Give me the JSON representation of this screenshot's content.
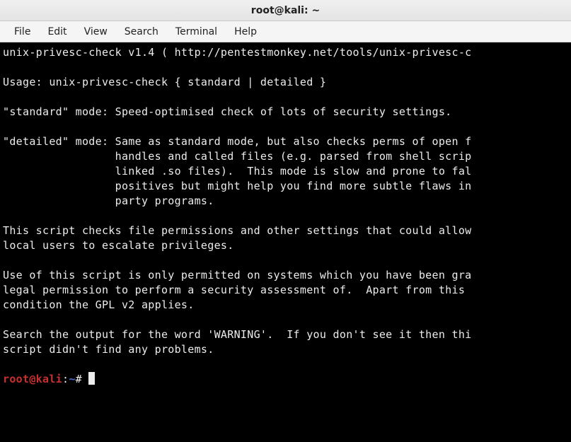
{
  "window": {
    "title": "root@kali: ~"
  },
  "menu": {
    "items": [
      "File",
      "Edit",
      "View",
      "Search",
      "Terminal",
      "Help"
    ]
  },
  "terminal": {
    "lines": [
      "unix-privesc-check v1.4 ( http://pentestmonkey.net/tools/unix-privesc-c",
      "",
      "Usage: unix-privesc-check { standard | detailed }",
      "",
      "\"standard\" mode: Speed-optimised check of lots of security settings.",
      "",
      "\"detailed\" mode: Same as standard mode, but also checks perms of open f",
      "                 handles and called files (e.g. parsed from shell scrip",
      "                 linked .so files).  This mode is slow and prone to fal",
      "                 positives but might help you find more subtle flaws in",
      "                 party programs.",
      "",
      "This script checks file permissions and other settings that could allow",
      "local users to escalate privileges.",
      "",
      "Use of this script is only permitted on systems which you have been gra",
      "legal permission to perform a security assessment of.  Apart from this ",
      "condition the GPL v2 applies.",
      "",
      "Search the output for the word 'WARNING'.  If you don't see it then thi",
      "script didn't find any problems.",
      ""
    ],
    "prompt": {
      "user": "root@kali",
      "sep": ":",
      "path": "~",
      "symbol": "#"
    }
  }
}
